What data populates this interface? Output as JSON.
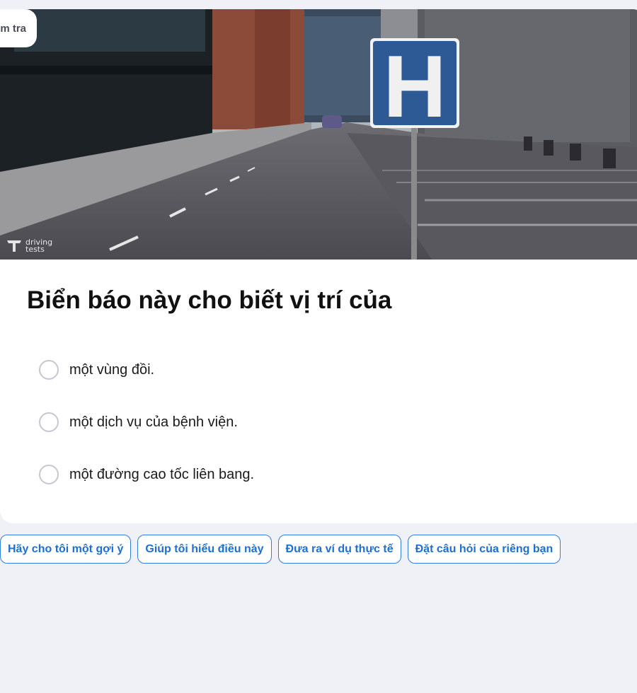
{
  "tag": {
    "label": "m tra"
  },
  "image": {
    "sign_letter": "H",
    "watermark_line1": "driving",
    "watermark_line2": "tests"
  },
  "question": {
    "text": "Biển báo này cho biết vị trí của"
  },
  "options": [
    {
      "label": "một vùng đồi."
    },
    {
      "label": "một dịch vụ của bệnh viện."
    },
    {
      "label": "một đường cao tốc liên bang."
    }
  ],
  "actions": [
    {
      "label": "Hãy cho tôi một gợi ý"
    },
    {
      "label": "Giúp tôi hiểu điều này"
    },
    {
      "label": "Đưa ra ví dụ thực tế"
    },
    {
      "label": "Đặt câu hỏi của riêng bạn"
    }
  ],
  "colors": {
    "accent": "#1d6fd6",
    "sign_blue": "#2d5a95",
    "background": "#f0f1f6"
  }
}
